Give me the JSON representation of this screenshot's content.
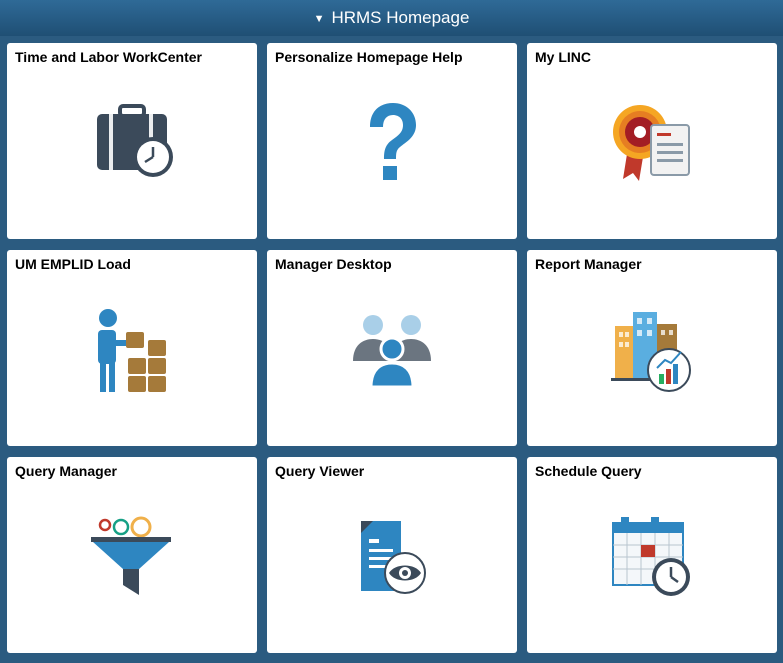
{
  "header": {
    "title": "HRMS Homepage"
  },
  "tiles": [
    {
      "label": "Time and Labor WorkCenter",
      "icon": "briefcase-clock-icon"
    },
    {
      "label": "Personalize Homepage Help",
      "icon": "question-mark-icon"
    },
    {
      "label": "My LINC",
      "icon": "award-document-icon"
    },
    {
      "label": "UM EMPLID Load",
      "icon": "person-stacking-boxes-icon"
    },
    {
      "label": "Manager Desktop",
      "icon": "team-people-icon"
    },
    {
      "label": "Report Manager",
      "icon": "buildings-chart-icon"
    },
    {
      "label": "Query Manager",
      "icon": "funnel-icon"
    },
    {
      "label": "Query Viewer",
      "icon": "document-eye-icon"
    },
    {
      "label": "Schedule Query",
      "icon": "calendar-clock-icon"
    }
  ],
  "colors": {
    "header_bg": "#2f6a97",
    "page_bg": "#2b5b80",
    "tile_bg": "#ffffff",
    "accent_blue": "#2e86c1",
    "dark_slate": "#3b4a5a"
  }
}
